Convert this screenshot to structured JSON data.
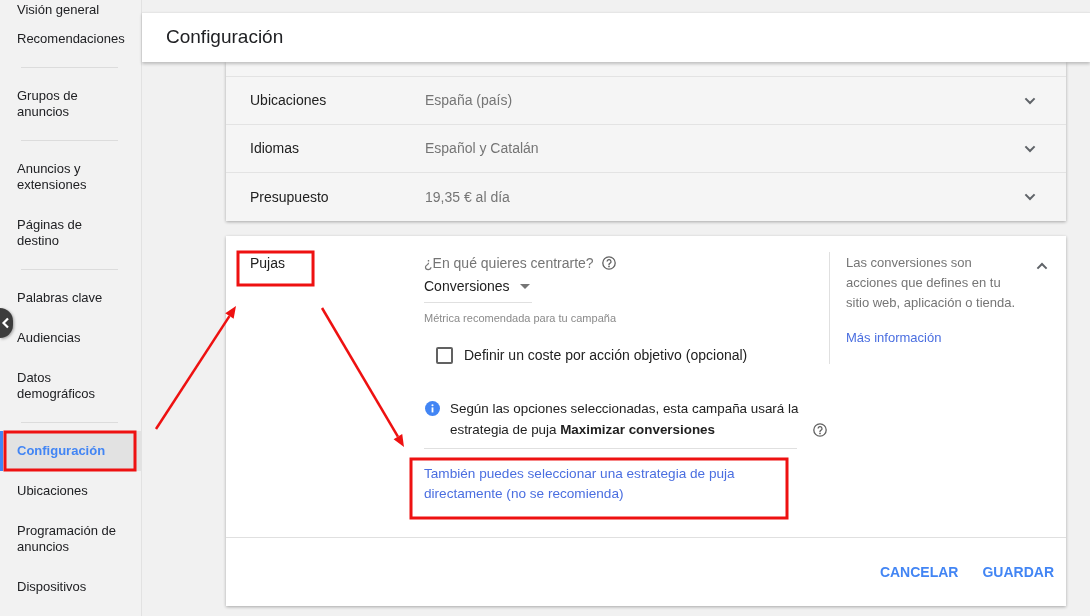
{
  "sidebar": {
    "groups": [
      {
        "items": [
          {
            "label": "Visión general",
            "selected": false
          },
          {
            "label": "Recomendaciones",
            "selected": false
          }
        ]
      },
      {
        "items": [
          {
            "label": "Grupos de anuncios",
            "selected": false
          }
        ]
      },
      {
        "items": [
          {
            "label": "Anuncios y extensiones",
            "selected": false
          },
          {
            "label": "Páginas de destino",
            "selected": false
          }
        ]
      },
      {
        "items": [
          {
            "label": "Palabras clave",
            "selected": false
          },
          {
            "label": "Audiencias",
            "selected": false
          },
          {
            "label": "Datos demográficos",
            "selected": false
          }
        ]
      },
      {
        "items": [
          {
            "label": "Configuración",
            "selected": true
          },
          {
            "label": "Ubicaciones",
            "selected": false
          },
          {
            "label": "Programación de anuncios",
            "selected": false
          },
          {
            "label": "Dispositivos",
            "selected": false
          }
        ]
      }
    ]
  },
  "header": {
    "title": "Configuración"
  },
  "settings_rows": [
    {
      "label": "Ubicaciones",
      "value": "España (país)",
      "expanded": false
    },
    {
      "label": "Idiomas",
      "value": "Español y Catalán",
      "expanded": false
    },
    {
      "label": "Presupuesto",
      "value": "19,35 € al día",
      "expanded": false
    }
  ],
  "bidding": {
    "label": "Pujas",
    "expanded": true,
    "question": "¿En qué quieres centrarte?",
    "focus_select": {
      "value": "Conversiones"
    },
    "hint": "Métrica recomendada para tu campaña",
    "target_cpa": {
      "label": "Definir un coste por acción objetivo (opcional)",
      "checked": false
    },
    "info": "Según las opciones seleccionadas, esta campaña usará la estrategia de puja **Maximizar conversiones**",
    "manual_link": "También puedes seleccionar una estrategia de puja directamente (no se recomienda)",
    "help": {
      "text": "Las conversiones son acciones que defines en tu sitio web, aplicación o tienda.",
      "link": "Más información"
    }
  },
  "actions": [
    {
      "label": "CANCELAR"
    },
    {
      "label": "GUARDAR"
    }
  ]
}
